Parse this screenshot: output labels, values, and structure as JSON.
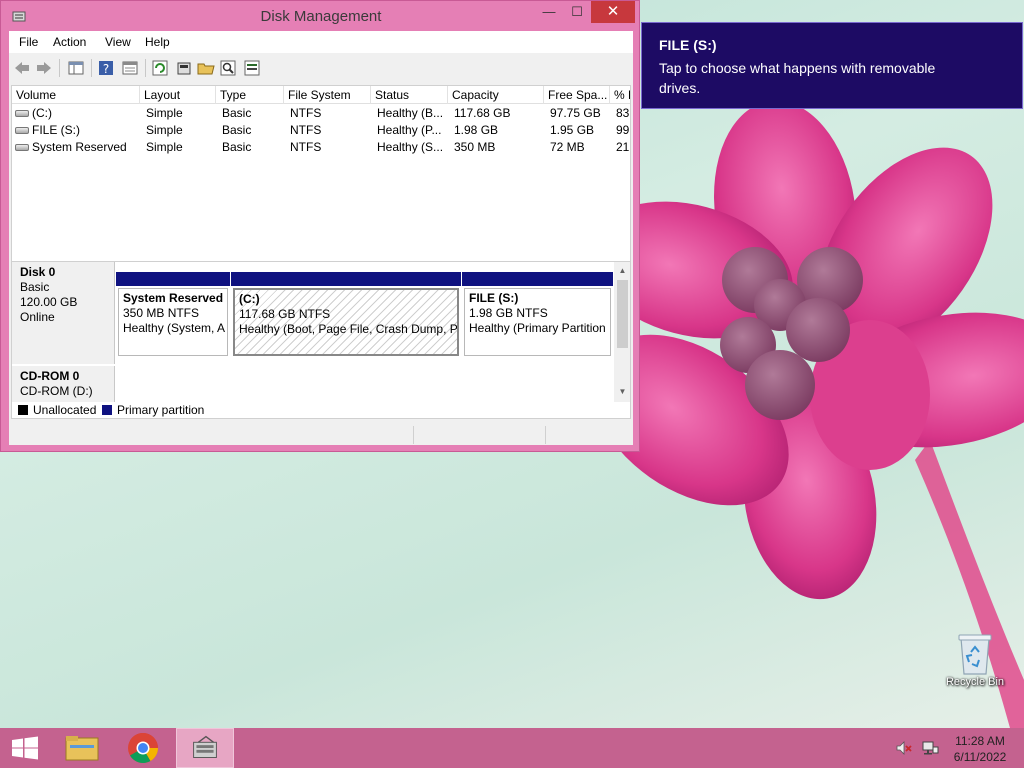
{
  "window": {
    "title": "Disk Management",
    "min_glyph": "—",
    "max_glyph": "☐",
    "close_glyph": "✕"
  },
  "menubar": {
    "items": [
      "File",
      "Action",
      "View",
      "Help"
    ]
  },
  "toolbar": {
    "icons": [
      "back-icon",
      "forward-icon",
      "console-tree-icon",
      "help-icon",
      "properties-icon",
      "refresh-icon",
      "settings-icon",
      "open-folder-icon",
      "search-icon",
      "export-icon"
    ]
  },
  "volume_list": {
    "columns": [
      "Volume",
      "Layout",
      "Type",
      "File System",
      "Status",
      "Capacity",
      "Free Spa...",
      "% F"
    ],
    "rows": [
      [
        "(C:)",
        "Simple",
        "Basic",
        "NTFS",
        "Healthy (B...",
        "117.68 GB",
        "97.75 GB",
        "83"
      ],
      [
        "FILE (S:)",
        "Simple",
        "Basic",
        "NTFS",
        "Healthy (P...",
        "1.98 GB",
        "1.95 GB",
        "99"
      ],
      [
        "System Reserved",
        "Simple",
        "Basic",
        "NTFS",
        "Healthy (S...",
        "350 MB",
        "72 MB",
        "21"
      ]
    ],
    "scroll_left": "◀",
    "scroll_right": "▶"
  },
  "disks": [
    {
      "name": "Disk 0",
      "lines": [
        "Basic",
        "120.00 GB",
        "Online"
      ],
      "partitions": [
        {
          "name": "System Reserved",
          "size": "350 MB NTFS",
          "status": "Healthy (System, A"
        },
        {
          "name": "(C:)",
          "size": "117.68 GB NTFS",
          "status": "Healthy (Boot, Page File, Crash Dump, Pr"
        },
        {
          "name": "FILE  (S:)",
          "size": "1.98 GB NTFS",
          "status": "Healthy (Primary Partition"
        }
      ]
    },
    {
      "name": "CD-ROM 0",
      "lines": [
        "CD-ROM (D:)"
      ]
    }
  ],
  "disk_scroll": {
    "up": "▲",
    "down": "▼"
  },
  "legend": {
    "items": [
      {
        "label": "Unallocated",
        "color": "#000000"
      },
      {
        "label": "Primary partition",
        "color": "#0f1280"
      }
    ]
  },
  "toast": {
    "title": "FILE (S:)",
    "message": "Tap to choose what happens with removable drives."
  },
  "desktop": {
    "recycle_bin": "Recycle Bin"
  },
  "taskbar": {
    "time": "11:28 AM",
    "date": "6/11/2022",
    "colors": {
      "taskbar": "#c4628f",
      "toast": "#1d0b64",
      "partition_bar": "#0f1280"
    }
  }
}
